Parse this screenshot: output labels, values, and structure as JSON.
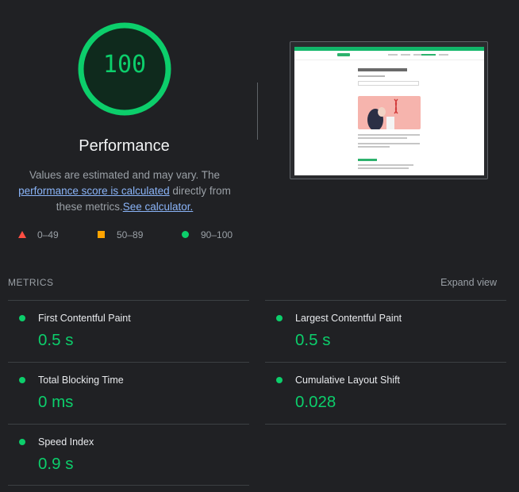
{
  "score": {
    "value": "100",
    "title": "Performance",
    "color": "#0cce6b"
  },
  "description": {
    "text_before": "Values are estimated and may vary. The ",
    "link1": "performance score is calculated",
    "text_middle": " directly from these metrics.",
    "link2": "See calculator."
  },
  "legend": [
    {
      "range": "0–49",
      "shape": "triangle",
      "color": "#ff4e42"
    },
    {
      "range": "50–89",
      "shape": "square",
      "color": "#ffa400"
    },
    {
      "range": "90–100",
      "shape": "circle",
      "color": "#0cce6b"
    }
  ],
  "metrics": {
    "header": "METRICS",
    "expand_label": "Expand view",
    "items": [
      {
        "label": "First Contentful Paint",
        "value": "0.5 s"
      },
      {
        "label": "Largest Contentful Paint",
        "value": "0.5 s"
      },
      {
        "label": "Total Blocking Time",
        "value": "0 ms"
      },
      {
        "label": "Cumulative Layout Shift",
        "value": "0.028"
      },
      {
        "label": "Speed Index",
        "value": "0.9 s"
      }
    ]
  }
}
